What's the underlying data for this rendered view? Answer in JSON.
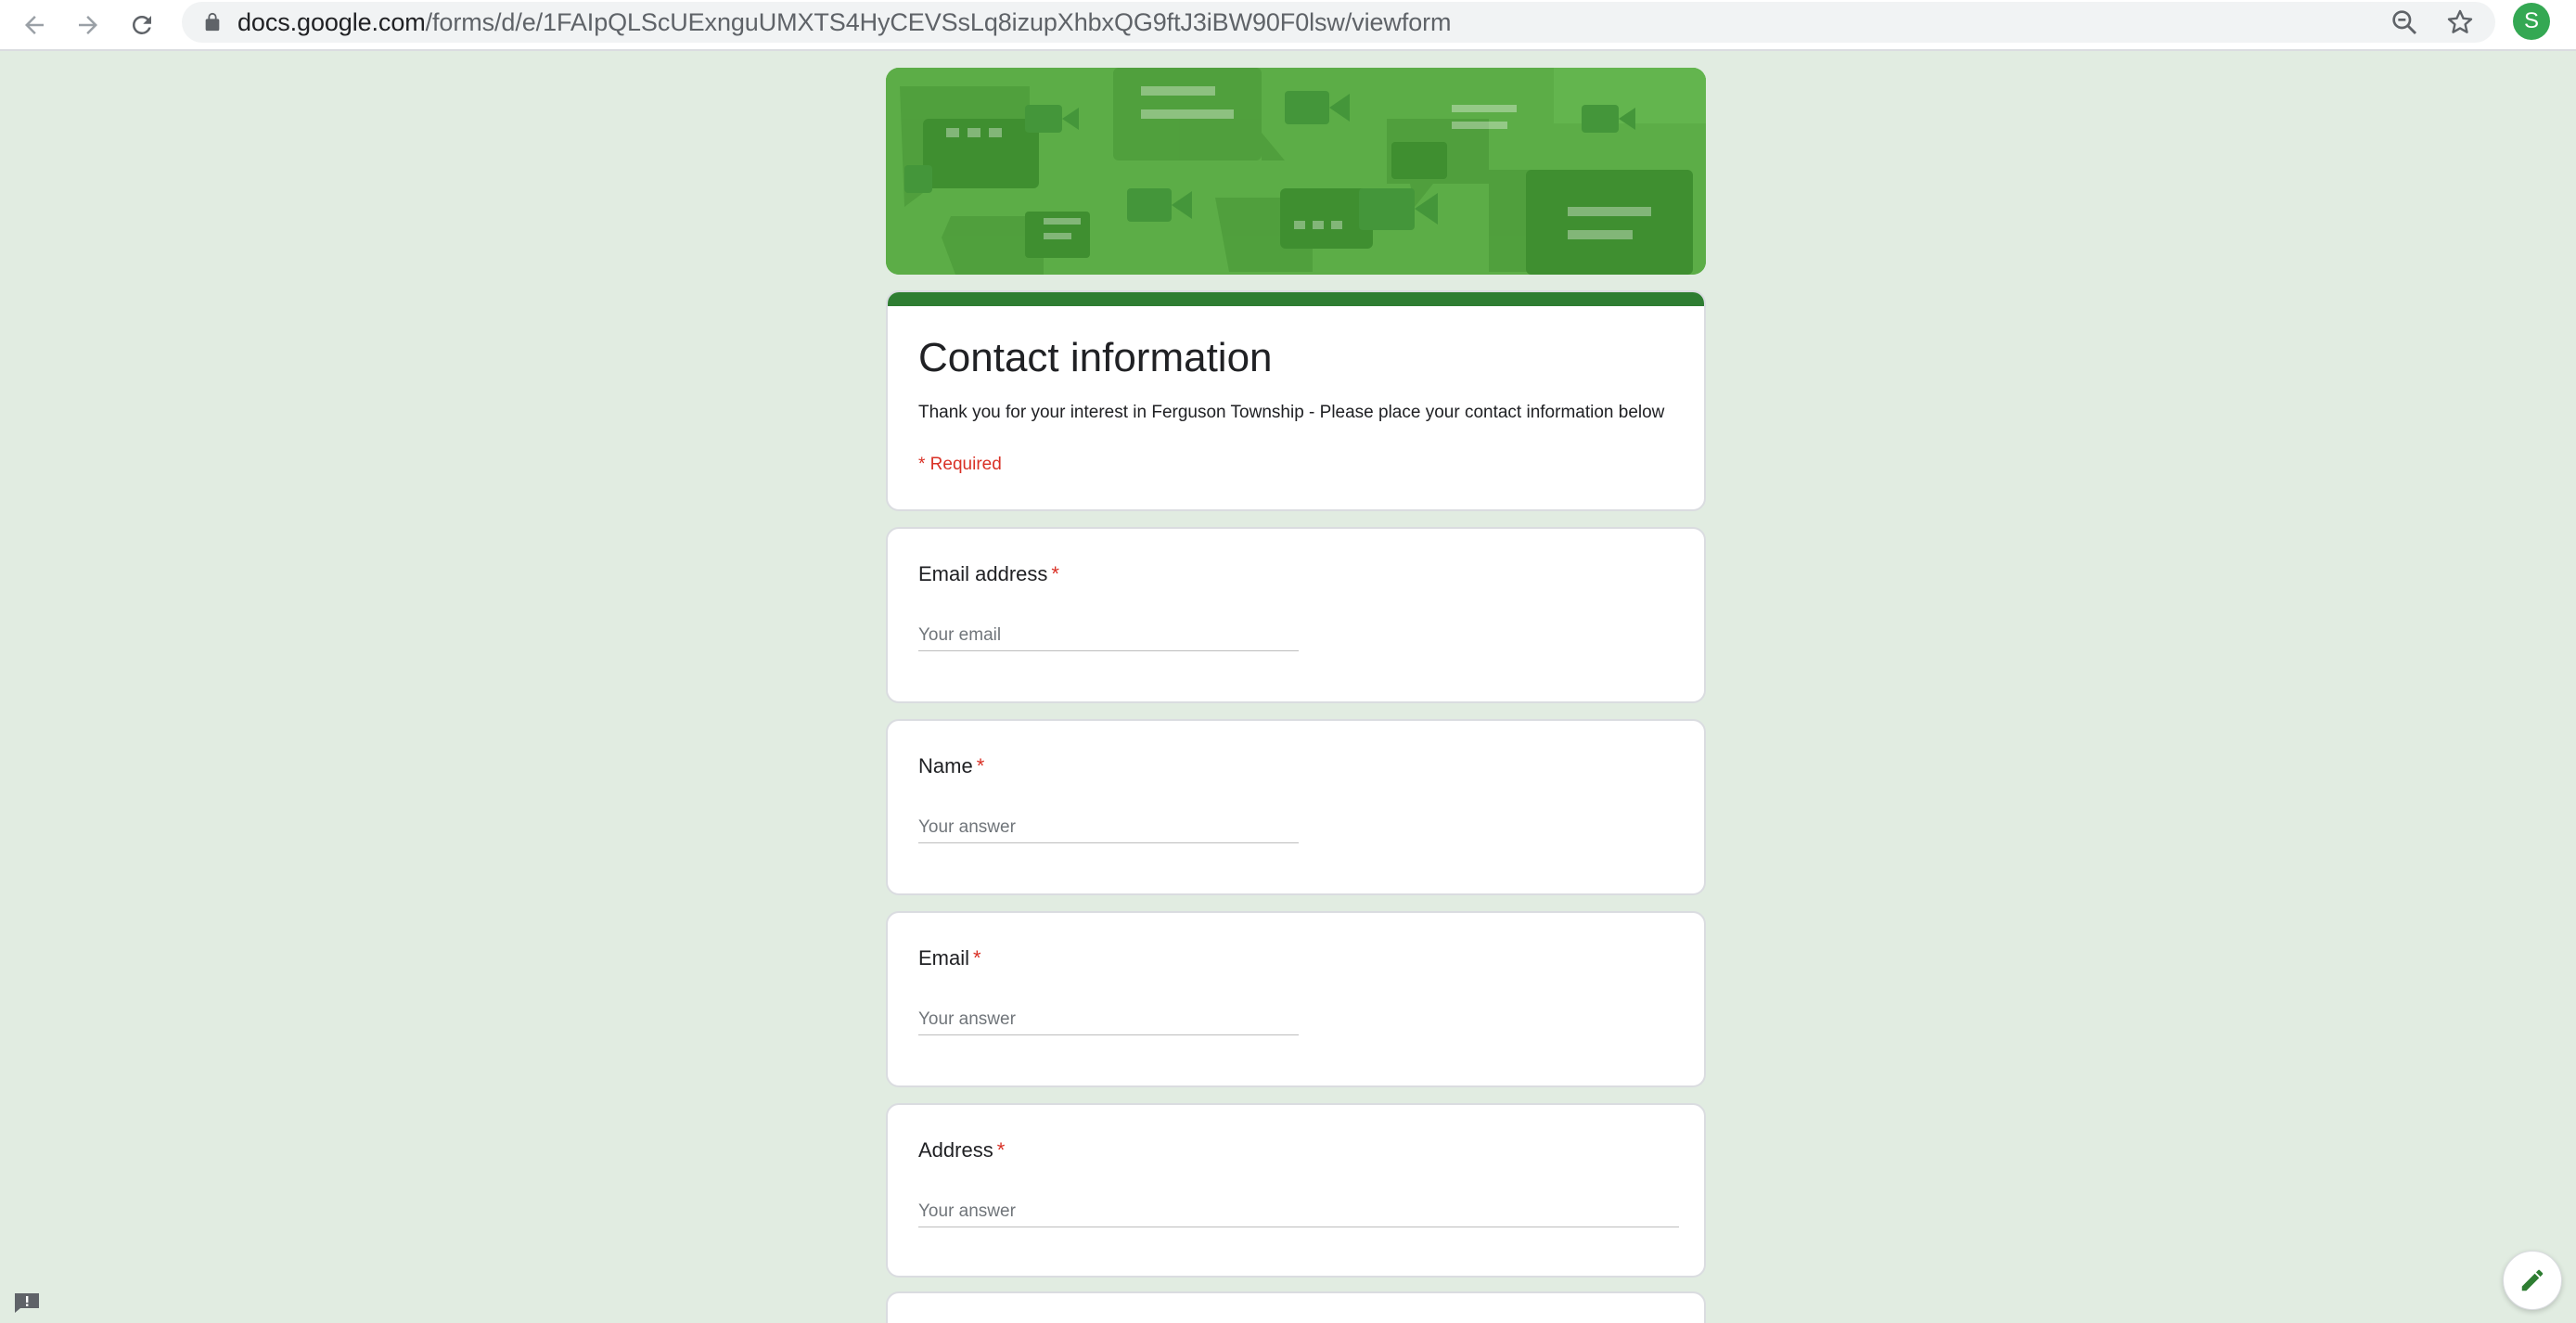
{
  "browser": {
    "url_host": "docs.google.com",
    "url_path": "/forms/d/e/1FAIpQLScUExnguUMXTS4HyCEVSsLq8izupXhbxQG9ftJ3iBW90F0lsw/viewform",
    "profile_initial": "S",
    "icons": {
      "back": "back-arrow-icon",
      "forward": "forward-arrow-icon",
      "reload": "reload-icon",
      "lock": "lock-icon",
      "zoom": "zoom-out-icon",
      "bookmark": "star-icon"
    }
  },
  "form": {
    "title": "Contact information",
    "description": "Thank you for your interest in Ferguson Township - Please place your contact information below",
    "required_note": "* Required",
    "questions": [
      {
        "label": "Email address",
        "required_mark": "*",
        "placeholder": "Your email"
      },
      {
        "label": "Name",
        "required_mark": "*",
        "placeholder": "Your answer"
      },
      {
        "label": "Email",
        "required_mark": "*",
        "placeholder": "Your answer"
      },
      {
        "label": "Address",
        "required_mark": "*",
        "placeholder": "Your answer"
      }
    ]
  },
  "colors": {
    "background": "#e1ece1",
    "header_green": "#5cad47",
    "accent_bar": "#2e7d32",
    "required_red": "#d93025",
    "avatar_green": "#34a853"
  }
}
